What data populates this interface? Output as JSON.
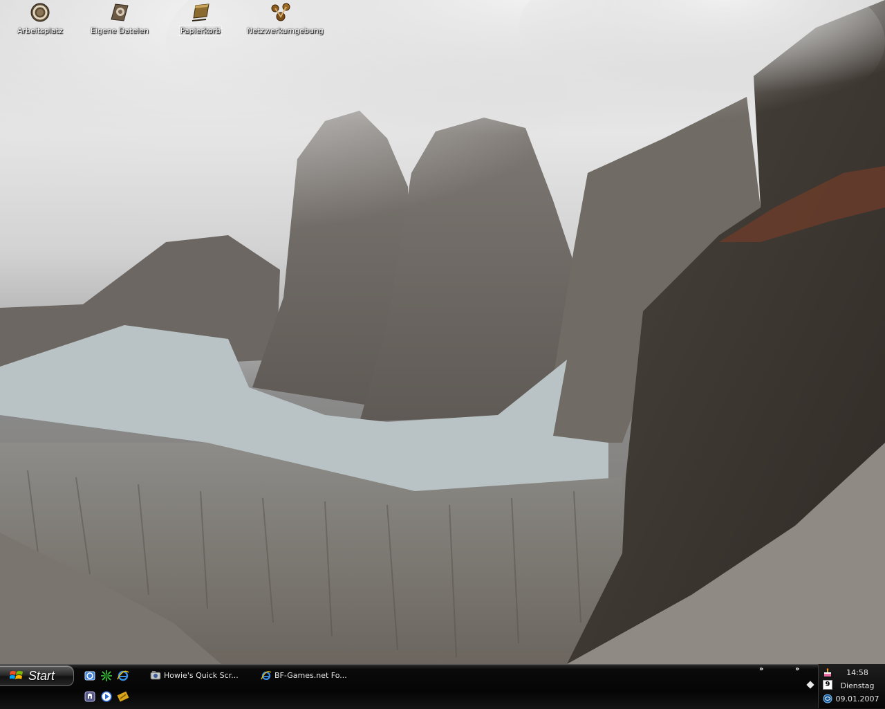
{
  "desktop": {
    "icons": [
      {
        "label": "Arbeitsplatz",
        "icon": "my-computer-icon"
      },
      {
        "label": "Eigene Dateien",
        "icon": "my-documents-icon"
      },
      {
        "label": "Papierkorb",
        "icon": "recycle-bin-icon",
        "selected": true
      },
      {
        "label": "Netzwerkumgebung",
        "icon": "network-places-icon"
      }
    ]
  },
  "taskbar": {
    "start_label": "Start",
    "quick_launch": [
      "outlook-icon",
      "daemon-tools-icon",
      "internet-explorer-icon",
      "winamp-icon",
      "media-player-icon",
      "shortcut-icon"
    ],
    "tasks": [
      {
        "label": "Howie's Quick Scr...",
        "icon": "screenshot-tool-icon"
      },
      {
        "label": "BF-Games.net Fo...",
        "icon": "internet-explorer-icon"
      }
    ],
    "overflow_left": "»",
    "overflow_right": "»"
  },
  "tray": {
    "icons": [
      "birthday-cake-icon",
      "calendar-icon",
      "network-icon"
    ],
    "calendar_day": "9",
    "time": "14:58",
    "weekday": "Dienstag",
    "date": "09.01.2007"
  },
  "colors": {
    "taskbar": "#050505",
    "label_text": "#ffffff",
    "tray_text": "#e6e6e6"
  }
}
